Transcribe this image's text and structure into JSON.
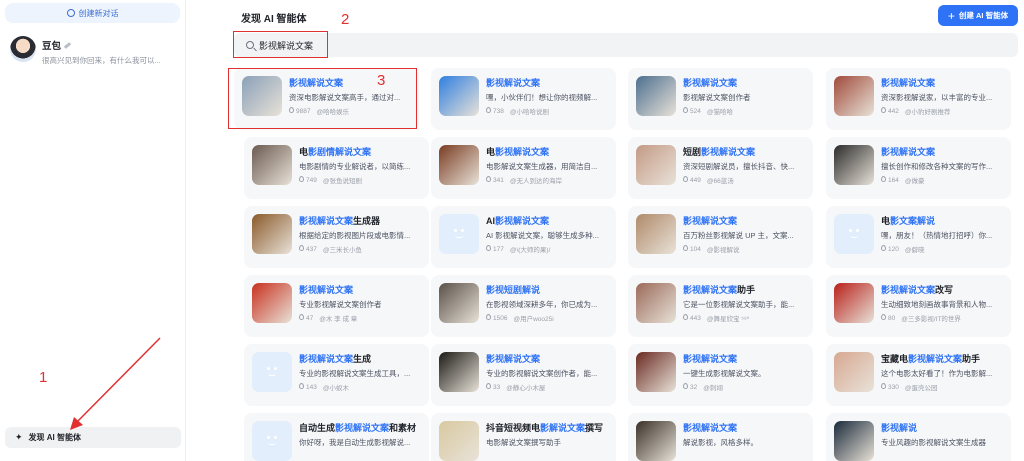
{
  "sidebar": {
    "new_chat_label": "创建新对话",
    "bot": {
      "name": "豆包",
      "message": "很高兴见到你回来，有什么我可以..."
    },
    "discover_label": "发现 AI 智能体"
  },
  "header": {
    "title": "发现 AI 智能体",
    "create_label": "创建 AI 智能体"
  },
  "search": {
    "value": "影视解说文案"
  },
  "annotations": [
    "1",
    "2",
    "3"
  ],
  "cards": [
    {
      "pre": "",
      "hl": "影视解说文案",
      "post": "",
      "desc": "资深电影解说文案高手，通过对...",
      "count": "9887",
      "author": "@哈哈娱乐",
      "thumb": "#8aa0b8"
    },
    {
      "pre": "",
      "hl": "影视解说文案",
      "post": "",
      "desc": "嘿，小伙伴们！想让你的视频解...",
      "count": "738",
      "author": "@小哈哈说剧",
      "thumb": "#2f7fe0"
    },
    {
      "pre": "",
      "hl": "影视解说文案",
      "post": "",
      "desc": "影视解说文案创作者",
      "count": "524",
      "author": "@猫哈哈",
      "thumb": "#4c6f8f"
    },
    {
      "pre": "",
      "hl": "影视解说文案",
      "post": "",
      "desc": "资深影视解说家，以丰富的专业...",
      "count": "442",
      "author": "@小豹好剧推荐",
      "thumb": "#a04a3a"
    },
    {
      "pre": "电",
      "hl": "影剧情解说文案",
      "post": "",
      "desc": "电影剧情的专业解说者，以简练...",
      "count": "749",
      "author": "@张鱼说短剧",
      "thumb": "#6b5a50"
    },
    {
      "pre": "电",
      "hl": "影视解说文案",
      "post": "",
      "desc": "电影解说文案生成器，用简洁自...",
      "count": "341",
      "author": "@无人到达的海岸",
      "thumb": "#7a3c22"
    },
    {
      "pre": "短剧",
      "hl": "影视解说文案",
      "post": "",
      "desc": "资深短剧解说员，擅长抖音、快...",
      "count": "449",
      "author": "@66蓝汤",
      "thumb": "#c49a86"
    },
    {
      "pre": "",
      "hl": "影视解说文案",
      "post": "",
      "desc": "擅长创作和修改各种文案的写作...",
      "count": "164",
      "author": "@做豪",
      "thumb": "#2b2b2b"
    },
    {
      "pre": "",
      "hl": "影视解说文案",
      "post": "生成器",
      "desc": "根据给定的影视图片段或电影情...",
      "count": "437",
      "author": "@三米长小鱼",
      "thumb": "#8a5a2a"
    },
    {
      "pre": "AI",
      "hl": "影视解说文案",
      "post": "",
      "desc": "AI 影视解说文案，聪够生成多种...",
      "count": "177",
      "author": "@\\(大师的果)/",
      "thumb": ""
    },
    {
      "pre": "",
      "hl": "影视解说文案",
      "post": "",
      "desc": "百万粉丝影视解说 UP 主，文案...",
      "count": "104",
      "author": "@影视解说",
      "thumb": "#b08a6a"
    },
    {
      "pre": "电",
      "hl": "影文案解说",
      "post": "",
      "desc": "嘿，朋友！（热情地打招呼）你...",
      "count": "120",
      "author": "@僻晓",
      "thumb": ""
    },
    {
      "pre": "",
      "hl": "影视解说文案",
      "post": "",
      "desc": "专业影视解说文案创作者",
      "count": "47",
      "author": "@木 李 成 章",
      "thumb": "#c8301e"
    },
    {
      "pre": "",
      "hl": "影视短剧解说",
      "post": "",
      "desc": "在影视领域深耕多年，你已成为...",
      "count": "1506",
      "author": "@用户woo25i",
      "thumb": "#5a5048"
    },
    {
      "pre": "",
      "hl": "影视解说文案",
      "post": "助手",
      "desc": "它是一位影视解说文案助手，能...",
      "count": "443",
      "author": "@舞星欣宝 ⁵⁸⁰",
      "thumb": "#9a6a5a"
    },
    {
      "pre": "",
      "hl": "影视解说文案",
      "post": "改写",
      "desc": "生动细致地刻画故事背景和人物...",
      "count": "80",
      "author": "@三多影视/IT的世界",
      "thumb": "#b8201a"
    },
    {
      "pre": "",
      "hl": "影视解说文案",
      "post": "生成",
      "desc": "专业的影视解说文案生成工具，...",
      "count": "143",
      "author": "@小蚁木",
      "thumb": ""
    },
    {
      "pre": "",
      "hl": "影视解说文案",
      "post": "",
      "desc": "专业的影视解说文案创作者，能...",
      "count": "33",
      "author": "@静心小木屋",
      "thumb": "#1c1a16"
    },
    {
      "pre": "",
      "hl": "影视解说文案",
      "post": "",
      "desc": "一键生成影视解说文案。",
      "count": "32",
      "author": "@刺翊",
      "thumb": "#6a2a22"
    },
    {
      "pre": "宝藏电",
      "hl": "影视解说文案",
      "post": "助手",
      "desc": "这个电影太好看了！作为电影解...",
      "count": "330",
      "author": "@蛋壳公园",
      "thumb": "#d7a892"
    },
    {
      "pre": "自动生成",
      "hl": "影视解说文案",
      "post": "和素材",
      "desc": "你好呀，我是自动生成影视解说...",
      "count": "",
      "author": "",
      "thumb": ""
    },
    {
      "pre": "抖音短视频电",
      "hl": "影解说文案",
      "post": "撰写",
      "desc": "电影解说文案撰写助手",
      "count": "",
      "author": "",
      "thumb": "#d9c9a0"
    },
    {
      "pre": "",
      "hl": "影视解说文案",
      "post": "",
      "desc": "解说影视，风格多样。",
      "count": "",
      "author": "",
      "thumb": "#3a3028"
    },
    {
      "pre": "",
      "hl": "影视解说",
      "post": "",
      "desc": "专业风趣的影视解说文案生成器",
      "count": "",
      "author": "",
      "thumb": "#1a2a3a"
    }
  ]
}
